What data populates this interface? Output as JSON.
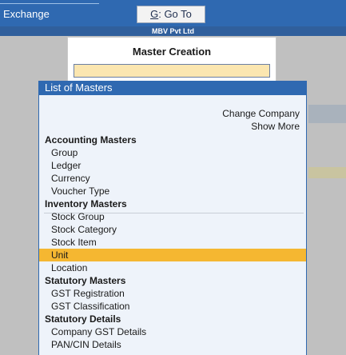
{
  "topbar": {
    "exchange_label": "Exchange",
    "goto_key": "G",
    "goto_label": ": Go To"
  },
  "company": {
    "name": "MBV Pvt Ltd"
  },
  "master_creation": {
    "title": "Master Creation",
    "input_value": ""
  },
  "list": {
    "title": "List of Masters",
    "actions": [
      "Change Company",
      "Show More"
    ],
    "groups": [
      {
        "label": "Accounting Masters",
        "items": [
          "Group",
          "Ledger",
          "Currency",
          "Voucher Type"
        ]
      },
      {
        "label": "Inventory Masters",
        "items": [
          "Stock Group",
          "Stock Category",
          "Stock Item",
          "Unit",
          "Location"
        ]
      },
      {
        "label": "Statutory Masters",
        "items": [
          "GST Registration",
          "GST Classification"
        ]
      },
      {
        "label": "Statutory Details",
        "items": [
          "Company GST Details",
          "PAN/CIN Details"
        ]
      }
    ],
    "selected": "Unit"
  },
  "colors": {
    "accent": "#2f69b1",
    "selection": "#f5b731",
    "input_bg": "#fbe6b0"
  }
}
